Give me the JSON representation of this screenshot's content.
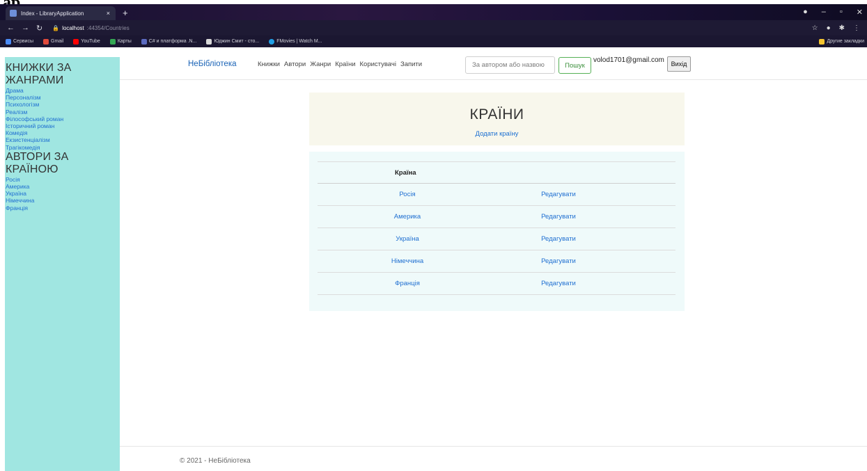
{
  "corner_glyph": "ap",
  "browser": {
    "tab_title": "Index - LibraryApplication",
    "tab_close": "×",
    "new_tab": "+",
    "url_host": "localhost",
    "url_path": ":44354/Countries",
    "bookmarks": [
      "Сервисы",
      "Gmail",
      "YouTube",
      "Карты",
      "C# и платформа .N...",
      "Юджин Смит - сто...",
      "FMovies | Watch M..."
    ],
    "other_bookmarks": "Другие закладки"
  },
  "sidebar": {
    "genres_heading": "КНИЖКИ ЗА ЖАНРАМИ",
    "genres": [
      "Драма",
      "Персоналізм",
      "Психологізм",
      "Реалізм",
      "Філософський роман",
      "Історичний роман",
      "Комедія",
      "Екзистенціалізм",
      "Трагікомедія"
    ],
    "authors_heading": "АВТОРИ ЗА КРАЇНОЮ",
    "countries": [
      "Росія",
      "Америка",
      "Україна",
      "Німеччина",
      "Франція"
    ]
  },
  "navbar": {
    "brand": "НеБібліотека",
    "links": [
      "Книжки",
      "Автори",
      "Жанри",
      "Країни",
      "Користувачі",
      "Запити"
    ],
    "search_placeholder": "За автором або назвою",
    "search_button": "Пошук",
    "user_email": "volod1701@gmail.com",
    "logout": "Вихід"
  },
  "main": {
    "title": "КРАЇНИ",
    "add_link": "Додати країну",
    "table": {
      "header": "Країна",
      "rows": [
        {
          "country": "Росія",
          "action": "Редагувати"
        },
        {
          "country": "Америка",
          "action": "Редагувати"
        },
        {
          "country": "Україна",
          "action": "Редагувати"
        },
        {
          "country": "Німеччина",
          "action": "Редагувати"
        },
        {
          "country": "Франція",
          "action": "Редагувати"
        }
      ]
    }
  },
  "footer": {
    "text": "© 2021 - НеБібліотека"
  }
}
